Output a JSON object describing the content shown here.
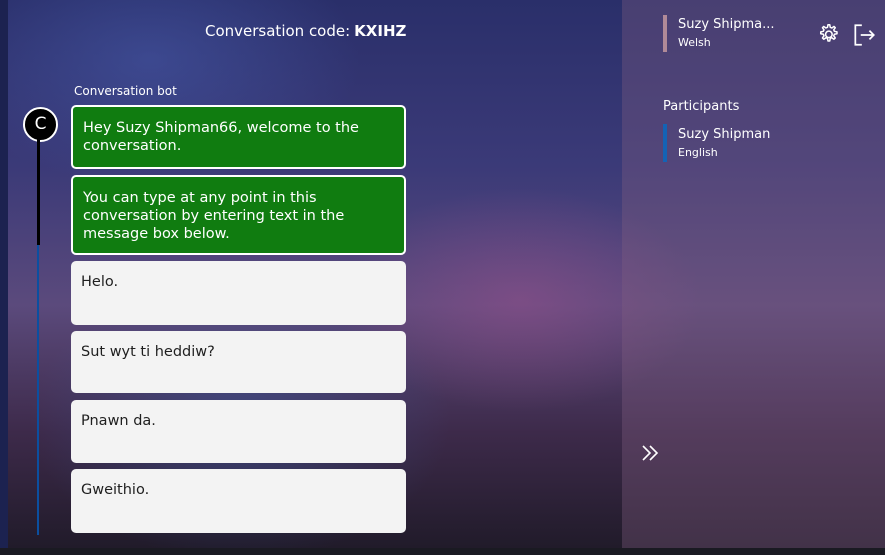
{
  "header": {
    "code_label": "Conversation code:",
    "code_value": "KXIHZ"
  },
  "chat": {
    "sender_label": "Conversation bot",
    "avatar_initial": "C",
    "messages": [
      {
        "type": "bot",
        "text": "Hey Suzy Shipman66, welcome to the conversation."
      },
      {
        "type": "bot",
        "text": "You can type at any point in this conversation by entering text in the message box below."
      },
      {
        "type": "user",
        "text": "Helo."
      },
      {
        "type": "user",
        "text": "Sut wyt ti heddiw?"
      },
      {
        "type": "user",
        "text": "Pnawn da."
      },
      {
        "type": "user",
        "text": "Gweithio."
      }
    ]
  },
  "current_user": {
    "name": "Suzy Shipma...",
    "language": "Welsh"
  },
  "participants": {
    "heading": "Participants",
    "items": [
      {
        "name": "Suzy Shipman",
        "language": "English"
      }
    ]
  },
  "icons": {
    "settings": "gear-icon",
    "exit": "exit-icon",
    "expand": "double-chevron-right-icon"
  },
  "colors": {
    "bot_bubble": "#107c10",
    "user_bubble": "#f3f3f3",
    "participant_accent": "#1463b5",
    "current_user_accent": "#b08a98"
  }
}
